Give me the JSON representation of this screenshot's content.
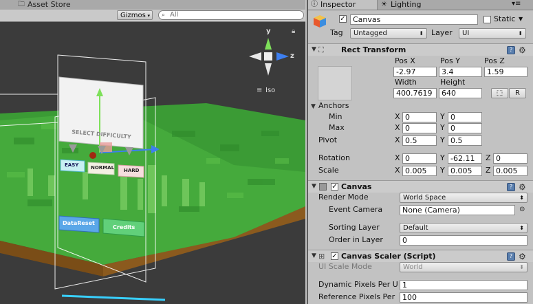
{
  "scene": {
    "tab_label": "Asset Store",
    "gizmos_label": "Gizmos",
    "search_placeholder": "All",
    "iso_label": "Iso",
    "gizmo_axes": {
      "y": "y",
      "z": "z"
    },
    "game_ui": {
      "title": "SELECT DIFFICULTY",
      "easy": "EASY",
      "normal": "NORMAL",
      "hard": "HARD",
      "data_reset": "DataReset",
      "credits": "Credits"
    }
  },
  "inspector": {
    "tab_inspector": "Inspector",
    "tab_lighting": "Lighting",
    "object_name": "Canvas",
    "static_label": "Static",
    "tag_label": "Tag",
    "tag_value": "Untagged",
    "layer_label": "Layer",
    "layer_value": "UI",
    "rect_transform": {
      "title": "Rect Transform",
      "pos_x_label": "Pos X",
      "pos_y_label": "Pos Y",
      "pos_z_label": "Pos Z",
      "pos_x": "-2.97",
      "pos_y": "3.4",
      "pos_z": "1.59",
      "width_label": "Width",
      "height_label": "Height",
      "width": "400.7619",
      "height": "640",
      "r_button": "R",
      "anchors_label": "Anchors",
      "min_label": "Min",
      "max_label": "Max",
      "min_x": "0",
      "min_y": "0",
      "max_x": "0",
      "max_y": "0",
      "pivot_label": "Pivot",
      "pivot_x": "0.5",
      "pivot_y": "0.5",
      "rotation_label": "Rotation",
      "rot_x": "0",
      "rot_y": "-62.11",
      "rot_z": "0",
      "scale_label": "Scale",
      "scale_x": "0.005",
      "scale_y": "0.005",
      "scale_z": "0.005",
      "x": "X",
      "y": "Y",
      "z": "Z"
    },
    "canvas": {
      "title": "Canvas",
      "render_mode_label": "Render Mode",
      "render_mode": "World Space",
      "event_camera_label": "Event Camera",
      "event_camera": "None (Camera)",
      "sorting_layer_label": "Sorting Layer",
      "sorting_layer": "Default",
      "order_in_layer_label": "Order in Layer",
      "order_in_layer": "0"
    },
    "canvas_scaler": {
      "title": "Canvas Scaler (Script)",
      "ui_scale_mode_label": "UI Scale Mode",
      "ui_scale_mode": "World",
      "dynamic_pixels_label": "Dynamic Pixels Per U",
      "dynamic_pixels": "1",
      "reference_pixels_label": "Reference Pixels Per",
      "reference_pixels": "100"
    }
  },
  "colors": {
    "accent_blue": "#3d7ff0",
    "grass": "#3fa33a",
    "dirt": "#8b5a1e",
    "sky_dark": "#3a3a3a"
  }
}
